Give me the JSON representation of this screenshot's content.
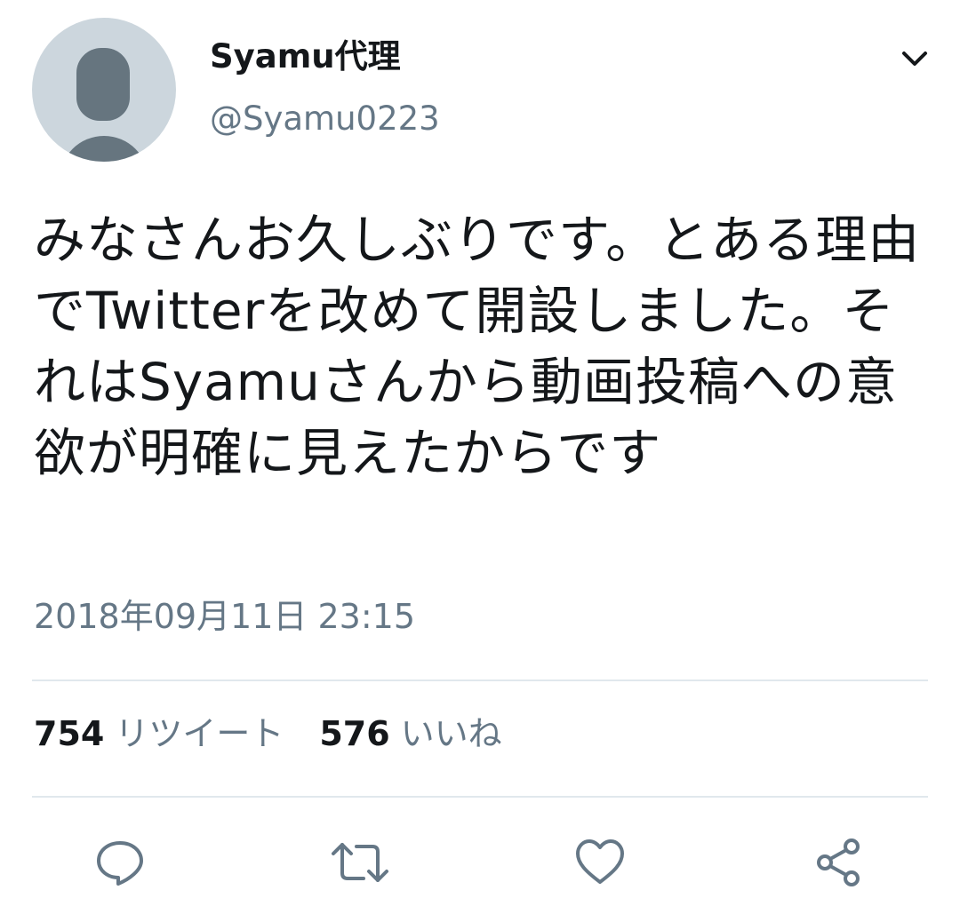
{
  "tweet": {
    "author": {
      "display_name": "Syamu代理",
      "handle": "@Syamu0223",
      "avatar_icon": "default-avatar-icon"
    },
    "text": "みなさんお久しぶりです。とある理由でTwitterを改めて開設しました。それはSyamuさんから動画投稿への意欲が明確に見えたからです",
    "timestamp": "2018年09月11日 23:15",
    "stats": {
      "retweets": {
        "count": "754",
        "label": "リツイート"
      },
      "likes": {
        "count": "576",
        "label": "いいね"
      }
    },
    "actions": [
      {
        "name": "reply",
        "icon": "reply-icon"
      },
      {
        "name": "retweet",
        "icon": "retweet-icon"
      },
      {
        "name": "like",
        "icon": "heart-icon"
      },
      {
        "name": "share",
        "icon": "share-icon"
      }
    ],
    "menu_icon": "chevron-down-icon"
  },
  "colors": {
    "text_primary": "#14171a",
    "text_secondary": "#657786",
    "avatar_bg": "#ccd6dd",
    "avatar_fg": "#66757f",
    "divider": "#e1e8ed"
  }
}
